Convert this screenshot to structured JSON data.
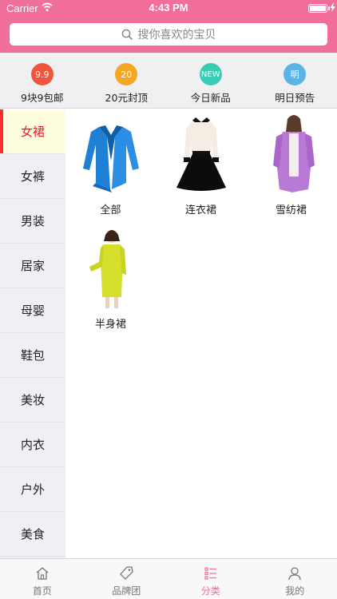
{
  "status": {
    "carrier": "Carrier",
    "time": "4:43 PM"
  },
  "search": {
    "placeholder": "搜你喜欢的宝贝"
  },
  "quick_nav": [
    {
      "badge": "9.9",
      "label": "9块9包邮",
      "color": "#f0553f"
    },
    {
      "badge": "20",
      "label": "20元封顶",
      "color": "#f5a623"
    },
    {
      "badge": "NEW",
      "label": "今日新品",
      "color": "#39cdb4"
    },
    {
      "badge": "明",
      "label": "明日预告",
      "color": "#5ab4e6"
    }
  ],
  "sidebar": {
    "items": [
      {
        "label": "女裙",
        "active": true
      },
      {
        "label": "女裤"
      },
      {
        "label": "男装"
      },
      {
        "label": "居家"
      },
      {
        "label": "母婴"
      },
      {
        "label": "鞋包"
      },
      {
        "label": "美妆"
      },
      {
        "label": "内衣"
      },
      {
        "label": "户外"
      },
      {
        "label": "美食"
      }
    ]
  },
  "categories": [
    {
      "label": "全部",
      "image": "blue-cardigan"
    },
    {
      "label": "连衣裙",
      "image": "black-white-dress"
    },
    {
      "label": "雪纺裙",
      "image": "purple-chiffon"
    },
    {
      "label": "半身裙",
      "image": "yellow-dress"
    }
  ],
  "tabbar": [
    {
      "label": "首页",
      "icon": "home-icon"
    },
    {
      "label": "品牌团",
      "icon": "tag-icon"
    },
    {
      "label": "分类",
      "icon": "list-icon",
      "active": true
    },
    {
      "label": "我的",
      "icon": "person-icon"
    }
  ],
  "colors": {
    "accent": "#f06e98",
    "active_text": "#e0202c",
    "active_bar": "#ff2a2a"
  }
}
